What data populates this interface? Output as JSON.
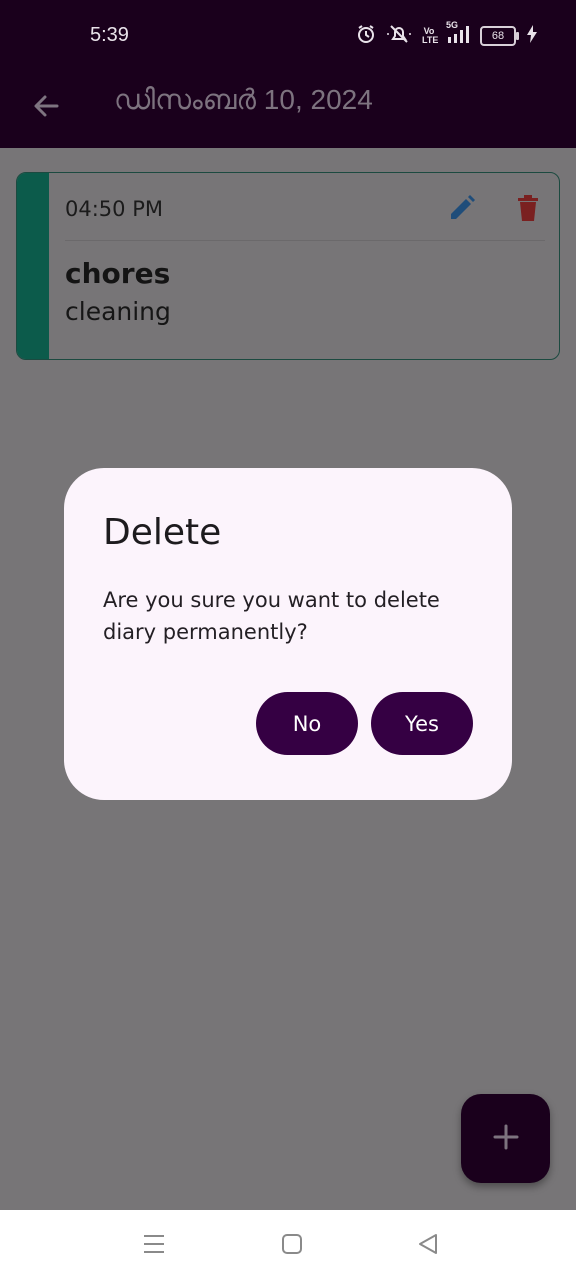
{
  "status_bar": {
    "time": "5:39",
    "network": "5G",
    "volte": "Vo LTE",
    "battery": "68",
    "icons": [
      "alarm-icon",
      "mute-icon",
      "volte-icon",
      "signal-icon",
      "battery-icon",
      "charging-icon"
    ]
  },
  "app_bar": {
    "title": "ഡിസംബർ 10, 2024",
    "back_icon": "arrow-back-icon"
  },
  "entry": {
    "time": "04:50 PM",
    "title": "chores",
    "body": "cleaning",
    "accent_color": "#0c5b4b",
    "edit_icon": "pencil-icon",
    "delete_icon": "trash-icon"
  },
  "dialog": {
    "title": "Delete",
    "message": "Are you sure you want to delete diary permanently?",
    "no_label": "No",
    "yes_label": "Yes",
    "button_color": "#350043"
  },
  "fab": {
    "icon": "plus-icon"
  },
  "nav_bar": {
    "icons": [
      "menu-icon",
      "home-icon",
      "back-triangle-icon"
    ]
  },
  "colors": {
    "app_bar": "#1a001c",
    "scrim_surface": "#777577",
    "dialog_surface": "#fcf4fc"
  }
}
